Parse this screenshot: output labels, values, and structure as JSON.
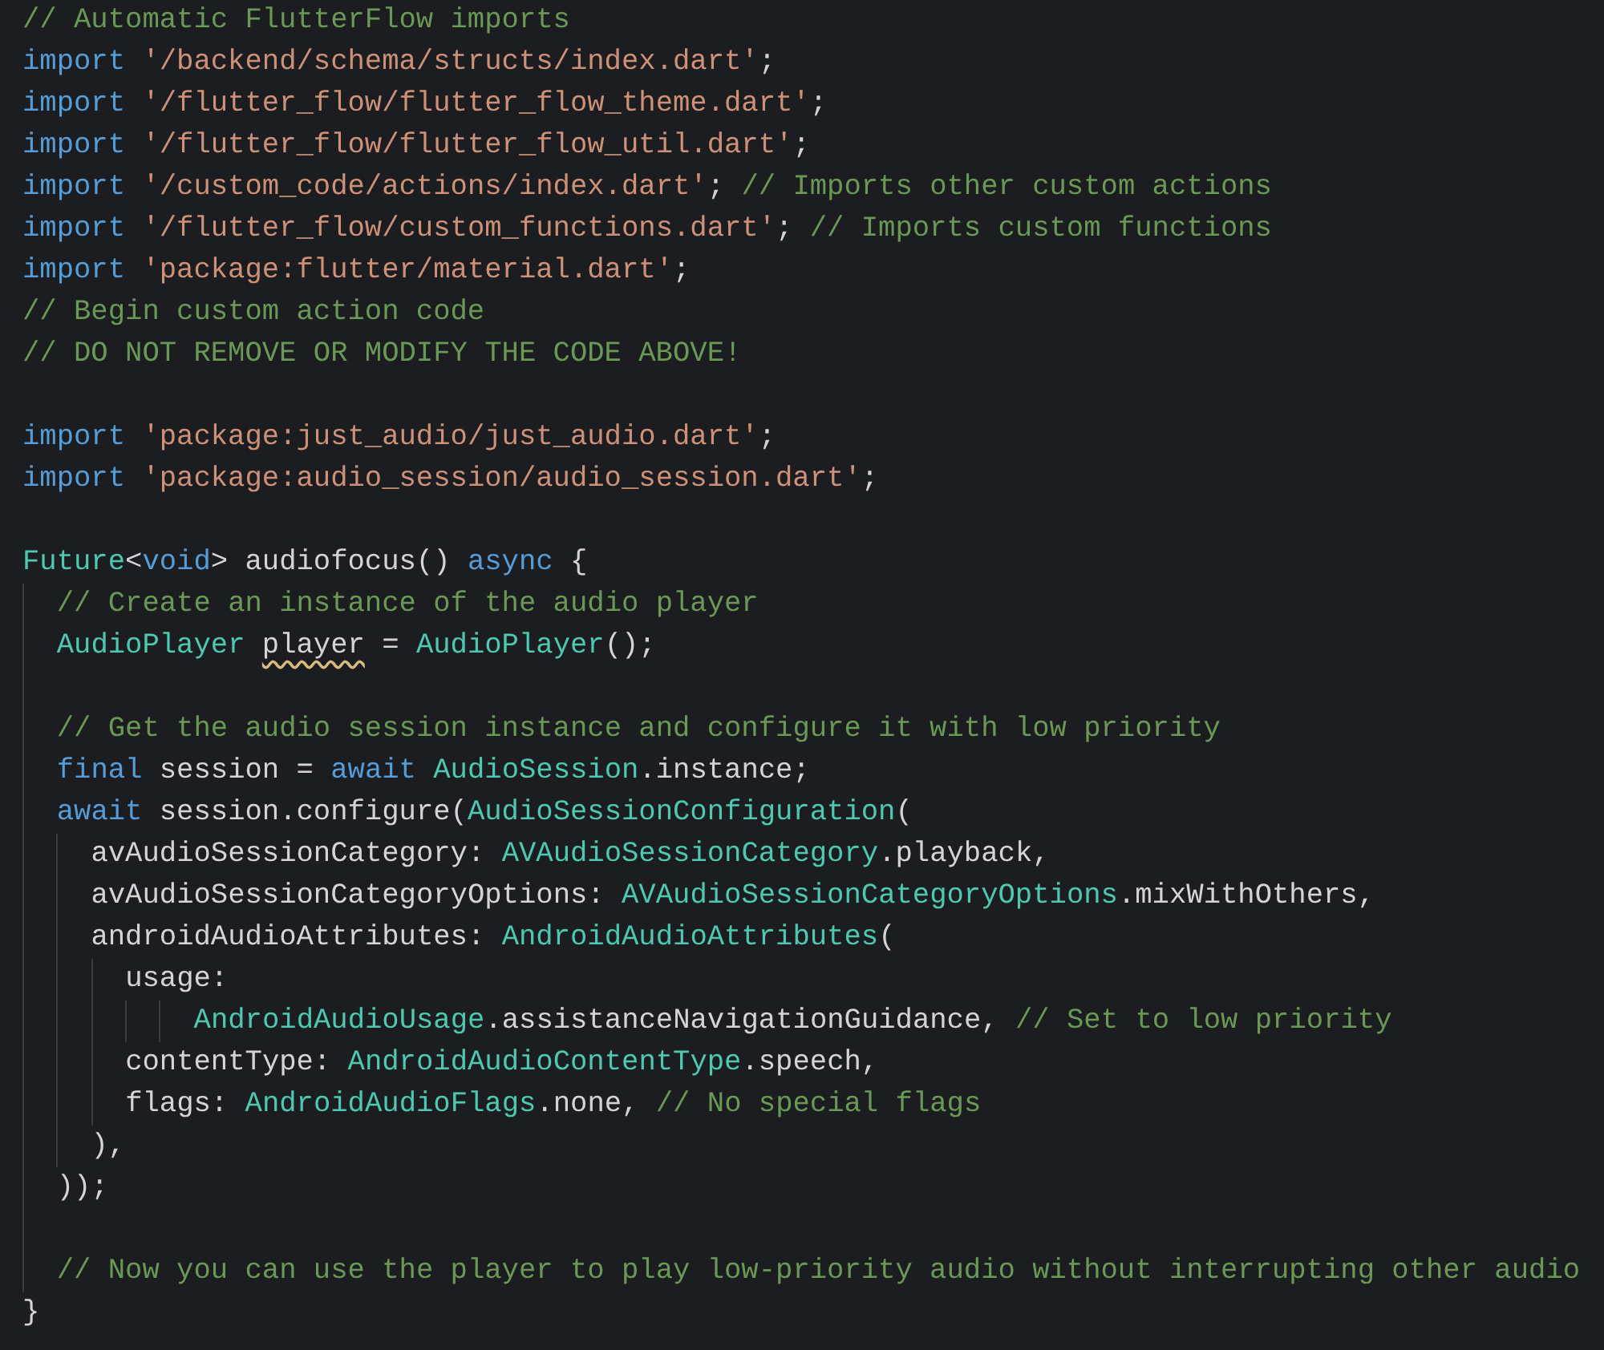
{
  "editor": {
    "lines": [
      {
        "kind": "code",
        "tokens": [
          {
            "kind": "comment",
            "text": "// Automatic FlutterFlow imports"
          }
        ]
      },
      {
        "kind": "code",
        "tokens": [
          {
            "kind": "keyword",
            "text": "import "
          },
          {
            "kind": "string",
            "text": "'/backend/schema/structs/index.dart'"
          },
          {
            "kind": "plain",
            "text": ";"
          }
        ]
      },
      {
        "kind": "code",
        "tokens": [
          {
            "kind": "keyword",
            "text": "import "
          },
          {
            "kind": "string",
            "text": "'/flutter_flow/flutter_flow_theme.dart'"
          },
          {
            "kind": "plain",
            "text": ";"
          }
        ]
      },
      {
        "kind": "code",
        "tokens": [
          {
            "kind": "keyword",
            "text": "import "
          },
          {
            "kind": "string",
            "text": "'/flutter_flow/flutter_flow_util.dart'"
          },
          {
            "kind": "plain",
            "text": ";"
          }
        ]
      },
      {
        "kind": "code",
        "tokens": [
          {
            "kind": "keyword",
            "text": "import "
          },
          {
            "kind": "string",
            "text": "'/custom_code/actions/index.dart'"
          },
          {
            "kind": "plain",
            "text": "; "
          },
          {
            "kind": "comment",
            "text": "// Imports other custom actions"
          }
        ]
      },
      {
        "kind": "code",
        "tokens": [
          {
            "kind": "keyword",
            "text": "import "
          },
          {
            "kind": "string",
            "text": "'/flutter_flow/custom_functions.dart'"
          },
          {
            "kind": "plain",
            "text": "; "
          },
          {
            "kind": "comment",
            "text": "// Imports custom functions"
          }
        ]
      },
      {
        "kind": "code",
        "tokens": [
          {
            "kind": "keyword",
            "text": "import "
          },
          {
            "kind": "string",
            "text": "'package:flutter/material.dart'"
          },
          {
            "kind": "plain",
            "text": ";"
          }
        ]
      },
      {
        "kind": "code",
        "tokens": [
          {
            "kind": "comment",
            "text": "// Begin custom action code"
          }
        ]
      },
      {
        "kind": "code",
        "tokens": [
          {
            "kind": "comment",
            "text": "// DO NOT REMOVE OR MODIFY THE CODE ABOVE!"
          }
        ]
      },
      {
        "kind": "blank"
      },
      {
        "kind": "code",
        "tokens": [
          {
            "kind": "keyword",
            "text": "import "
          },
          {
            "kind": "string",
            "text": "'package:just_audio/just_audio.dart'"
          },
          {
            "kind": "plain",
            "text": ";"
          }
        ]
      },
      {
        "kind": "code",
        "tokens": [
          {
            "kind": "keyword",
            "text": "import "
          },
          {
            "kind": "string",
            "text": "'package:audio_session/audio_session.dart'"
          },
          {
            "kind": "plain",
            "text": ";"
          }
        ]
      },
      {
        "kind": "blank"
      },
      {
        "kind": "code",
        "tokens": [
          {
            "kind": "type",
            "text": "Future"
          },
          {
            "kind": "plain",
            "text": "<"
          },
          {
            "kind": "keyword",
            "text": "void"
          },
          {
            "kind": "plain",
            "text": "> audiofocus() "
          },
          {
            "kind": "keyword",
            "text": "async"
          },
          {
            "kind": "plain",
            "text": " {"
          }
        ],
        "children": [
          {
            "kind": "code",
            "tokens": [
              {
                "kind": "comment",
                "text": "// Create an instance of the audio player"
              }
            ]
          },
          {
            "kind": "code",
            "tokens": [
              {
                "kind": "type",
                "text": "AudioPlayer "
              },
              {
                "kind": "plain",
                "text": "player",
                "warning": true
              },
              {
                "kind": "plain",
                "text": " = "
              },
              {
                "kind": "type",
                "text": "AudioPlayer"
              },
              {
                "kind": "plain",
                "text": "();"
              }
            ]
          },
          {
            "kind": "blank"
          },
          {
            "kind": "code",
            "tokens": [
              {
                "kind": "comment",
                "text": "// Get the audio session instance and configure it with low priority"
              }
            ]
          },
          {
            "kind": "code",
            "tokens": [
              {
                "kind": "keyword",
                "text": "final"
              },
              {
                "kind": "plain",
                "text": " session = "
              },
              {
                "kind": "keyword",
                "text": "await "
              },
              {
                "kind": "type",
                "text": "AudioSession"
              },
              {
                "kind": "plain",
                "text": ".instance;"
              }
            ]
          },
          {
            "kind": "code",
            "tokens": [
              {
                "kind": "keyword",
                "text": "await"
              },
              {
                "kind": "plain",
                "text": " session.configure("
              },
              {
                "kind": "type",
                "text": "AudioSessionConfiguration"
              },
              {
                "kind": "plain",
                "text": "("
              }
            ],
            "children": [
              {
                "kind": "code",
                "tokens": [
                  {
                    "kind": "plain",
                    "text": "avAudioSessionCategory: "
                  },
                  {
                    "kind": "type",
                    "text": "AVAudioSessionCategory"
                  },
                  {
                    "kind": "plain",
                    "text": ".playback,"
                  }
                ]
              },
              {
                "kind": "code",
                "tokens": [
                  {
                    "kind": "plain",
                    "text": "avAudioSessionCategoryOptions: "
                  },
                  {
                    "kind": "type",
                    "text": "AVAudioSessionCategoryOptions"
                  },
                  {
                    "kind": "plain",
                    "text": ".mixWithOthers,"
                  }
                ]
              },
              {
                "kind": "code",
                "tokens": [
                  {
                    "kind": "plain",
                    "text": "androidAudioAttributes: "
                  },
                  {
                    "kind": "type",
                    "text": "AndroidAudioAttributes"
                  },
                  {
                    "kind": "plain",
                    "text": "("
                  }
                ],
                "children": [
                  {
                    "kind": "code",
                    "tokens": [
                      {
                        "kind": "plain",
                        "text": "usage:"
                      }
                    ],
                    "children": [
                      {
                        "kind": "wrap",
                        "children": [
                          {
                            "kind": "code",
                            "tokens": [
                              {
                                "kind": "type",
                                "text": "AndroidAudioUsage"
                              },
                              {
                                "kind": "plain",
                                "text": ".assistanceNavigationGuidance, "
                              },
                              {
                                "kind": "comment",
                                "text": "// Set to low priority"
                              }
                            ]
                          }
                        ]
                      }
                    ]
                  },
                  {
                    "kind": "code",
                    "tokens": [
                      {
                        "kind": "plain",
                        "text": "contentType: "
                      },
                      {
                        "kind": "type",
                        "text": "AndroidAudioContentType"
                      },
                      {
                        "kind": "plain",
                        "text": ".speech,"
                      }
                    ]
                  },
                  {
                    "kind": "code",
                    "tokens": [
                      {
                        "kind": "plain",
                        "text": "flags: "
                      },
                      {
                        "kind": "type",
                        "text": "AndroidAudioFlags"
                      },
                      {
                        "kind": "plain",
                        "text": ".none, "
                      },
                      {
                        "kind": "comment",
                        "text": "// No special flags"
                      }
                    ]
                  }
                ]
              },
              {
                "kind": "code",
                "tokens": [
                  {
                    "kind": "plain",
                    "text": "),"
                  }
                ]
              }
            ]
          },
          {
            "kind": "code",
            "tokens": [
              {
                "kind": "plain",
                "text": "));"
              }
            ]
          },
          {
            "kind": "blank"
          },
          {
            "kind": "code",
            "tokens": [
              {
                "kind": "comment",
                "text": "// Now you can use the player to play low-priority audio without interrupting other audio"
              }
            ]
          }
        ]
      },
      {
        "kind": "code",
        "tokens": [
          {
            "kind": "plain",
            "text": "}"
          }
        ]
      }
    ]
  }
}
